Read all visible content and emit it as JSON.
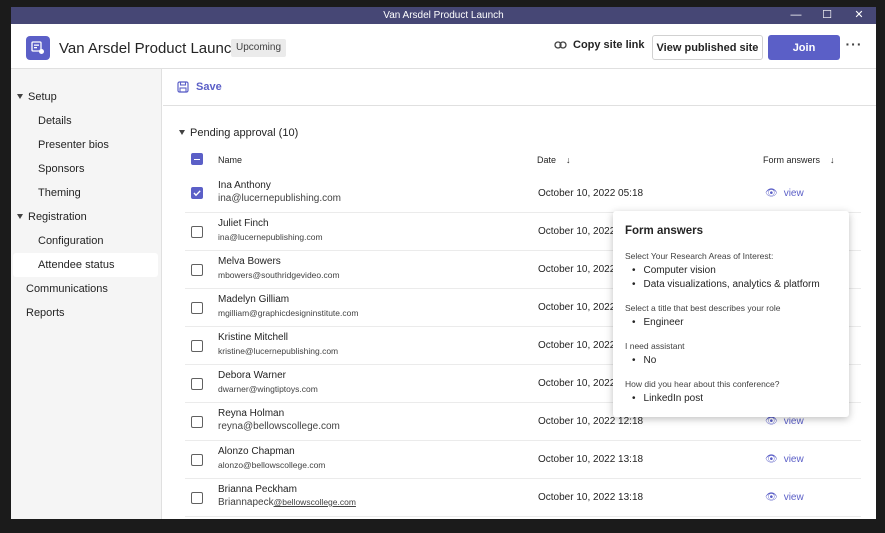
{
  "window": {
    "title": "Van Arsdel Product Launch"
  },
  "header": {
    "title": "Van Arsdel Product Launch",
    "badge": "Upcoming",
    "copy_link": "Copy site link",
    "view_site": "View published site",
    "join": "Join",
    "more": "···"
  },
  "sidebar": {
    "items": [
      {
        "label": "Setup",
        "expandable": true
      },
      {
        "label": "Details"
      },
      {
        "label": "Presenter bios"
      },
      {
        "label": "Sponsors"
      },
      {
        "label": "Theming"
      },
      {
        "label": "Registration",
        "expandable": true
      },
      {
        "label": "Configuration"
      },
      {
        "label": "Attendee status",
        "selected": true
      },
      {
        "label": "Communications"
      },
      {
        "label": "Reports"
      }
    ]
  },
  "toolbar": {
    "save": "Save"
  },
  "section": {
    "title": "Pending approval (10)"
  },
  "table": {
    "columns": {
      "name": "Name",
      "date": "Date",
      "form": "Form answers"
    },
    "view_label": "view",
    "rows": [
      {
        "name": "Ina Anthony",
        "email": "ina@lucernepublishing.com",
        "date": "October 10, 2022 05:18",
        "checked": true
      },
      {
        "name": "Juliet Finch",
        "email": "ina@lucernepublishing.com",
        "date": "October 10, 2022 05:18"
      },
      {
        "name": "Melva Bowers",
        "email": "mbowers@southridgevideo.com",
        "date": "October 10, 2022 05:18"
      },
      {
        "name": "Madelyn Gilliam",
        "email": "mgilliam@graphicdesigninstitute.com",
        "date": "October 10, 2022 05:18"
      },
      {
        "name": "Kristine Mitchell",
        "email": "kristine@lucernepublishing.com",
        "date": "October 10, 2022 05:18"
      },
      {
        "name": "Debora Warner",
        "email": "dwarner@wingtiptoys.com",
        "date": "October 10, 2022 05:18"
      },
      {
        "name": "Reyna Holman",
        "email": "reyna@bellowscollege.com",
        "date": "October 10, 2022 12:18"
      },
      {
        "name": "Alonzo Chapman",
        "email": "alonzo@bellowscollege.com",
        "date": "October 10, 2022 13:18"
      },
      {
        "name": "Brianna Peckham",
        "email_prefix": "Briannapeck",
        "email_suffix": "@bellowscollege.com",
        "date": "October 10, 2022 13:18"
      }
    ]
  },
  "popover": {
    "title": "Form answers",
    "q1": "Select Your Research Areas of Interest:",
    "q1_a1": "Computer vision",
    "q1_a2": "Data visualizations, analytics & platform",
    "q2": "Select a title that best describes your role",
    "q2_a1": "Engineer",
    "q3": "I need assistant",
    "q3_a1": "No",
    "q4": "How did you hear about this conference?",
    "q4_a1": "LinkedIn post"
  },
  "colors": {
    "accent": "#5b5fc7",
    "titlebar": "#464775"
  }
}
